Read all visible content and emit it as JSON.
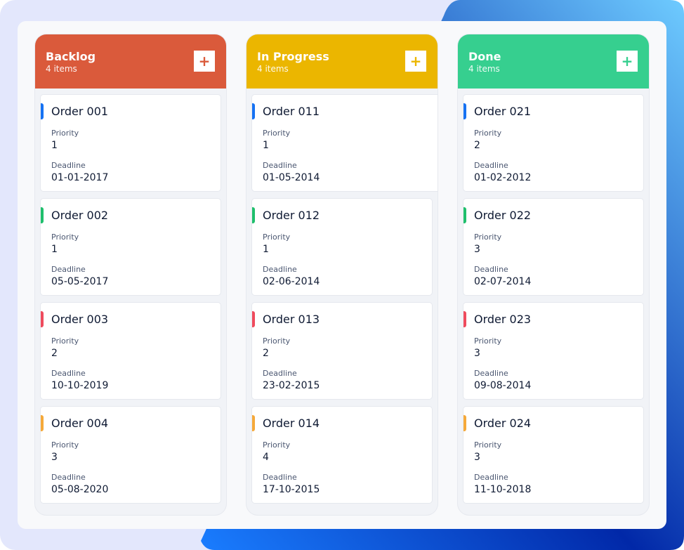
{
  "colors": {
    "background": "#e3e7fc",
    "board": "#f8f9fb",
    "accent_blue_light": "#6ecbff",
    "accent_blue_dark": "#0128a8"
  },
  "indicator_colors": {
    "blue": "#1672f3",
    "green": "#1fbf6c",
    "red": "#ef4b5d",
    "orange": "#f5a93a"
  },
  "labels": {
    "priority": "Priority",
    "deadline": "Deadline",
    "add_icon": "+"
  },
  "columns": [
    {
      "title": "Backlog",
      "count": "4 items",
      "color": "#da5a3b",
      "cards": [
        {
          "title": "Order 001",
          "priority": "1",
          "deadline": "01-01-2017",
          "indicator": "blue"
        },
        {
          "title": "Order 002",
          "priority": "1",
          "deadline": "05-05-2017",
          "indicator": "green"
        },
        {
          "title": "Order 003",
          "priority": "2",
          "deadline": "10-10-2019",
          "indicator": "red"
        },
        {
          "title": "Order 004",
          "priority": "3",
          "deadline": "05-08-2020",
          "indicator": "orange"
        }
      ]
    },
    {
      "title": "In Progress",
      "count": "4 items",
      "color": "#ebb600",
      "cards": [
        {
          "title": "Order 011",
          "priority": "1",
          "deadline": "01-05-2014",
          "indicator": "blue"
        },
        {
          "title": "Order 012",
          "priority": "1",
          "deadline": "02-06-2014",
          "indicator": "green"
        },
        {
          "title": "Order 013",
          "priority": "2",
          "deadline": "23-02-2015",
          "indicator": "red"
        },
        {
          "title": "Order 014",
          "priority": "4",
          "deadline": "17-10-2015",
          "indicator": "orange"
        }
      ]
    },
    {
      "title": "Done",
      "count": "4 items",
      "color": "#36cf8f",
      "cards": [
        {
          "title": "Order 021",
          "priority": "2",
          "deadline": "01-02-2012",
          "indicator": "blue"
        },
        {
          "title": "Order 022",
          "priority": "3",
          "deadline": "02-07-2014",
          "indicator": "green"
        },
        {
          "title": "Order 023",
          "priority": "3",
          "deadline": "09-08-2014",
          "indicator": "red"
        },
        {
          "title": "Order 024",
          "priority": "3",
          "deadline": "11-10-2018",
          "indicator": "orange"
        }
      ]
    }
  ]
}
